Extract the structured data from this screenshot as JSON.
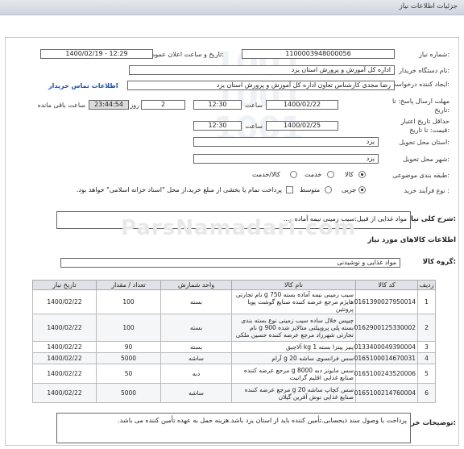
{
  "page_title": "جزئیات اطلاعات نیاز",
  "watermark": "ParsNamadari.com",
  "fields": {
    "need_number": {
      "label": "شماره نیاز:",
      "value": "1100003948000056"
    },
    "announce_datetime": {
      "label": "تاریخ و ساعت اعلان عمومی:",
      "value": "1400/02/19 - 12:29"
    },
    "buyer_org": {
      "label": "نام دستگاه خریدار:",
      "value": "اداره کل آموزش و پرورش استان یزد"
    },
    "requester": {
      "label": "ایجاد کننده درخواست:",
      "value": "رضا مجدی کارشناس تعاون اداره کل آموزش و پرورش استان یزد",
      "link": "اطلاعات تماس خریدار"
    },
    "reply_deadline": {
      "label": "مهلت ارسال پاسخ: تا تاریخ:",
      "date": "1400/02/22",
      "time_label": "ساعت",
      "time": "12:30",
      "days": "2",
      "days_label": "روز و",
      "remaining": "23:44:54",
      "remaining_label": "ساعت باقی مانده"
    },
    "price_validity": {
      "label": "حداقل تاریخ اعتبار قیمت: تا تاریخ:",
      "date": "1400/02/25",
      "time_label": "ساعت",
      "time": "12:30"
    },
    "delivery_province": {
      "label": "استان محل تحویل:",
      "value": "یزد"
    },
    "delivery_city": {
      "label": "شهر محل تحویل:",
      "value": "یزد"
    },
    "category": {
      "label": "طبقه بندی موضوعی:",
      "options": [
        "کالا",
        "خدمت",
        "کالا/خدمت"
      ],
      "selected": "کالا"
    },
    "purchase_type": {
      "label": "نوع فرآیند خرید :",
      "options": [
        "جزیی",
        "متوسط"
      ],
      "selected": "جزیی",
      "note": "پرداخت تمام یا بخشی از مبلغ خرید،از محل \"اسناد خزانه اسلامی\" خواهد بود."
    }
  },
  "summary": {
    "label": "شرح کلی نیاز:",
    "value": "مواد غذایی از قبیل:سیب زمینی نیمه آماده و..."
  },
  "goods_section": {
    "title": "اطلاعات کالاهای مورد نیاز",
    "group_label": "گروه کالا:",
    "group_value": "مواد غذایی و نوشیدنی"
  },
  "table": {
    "headers": [
      "ردیف",
      "کد کالا",
      "نام کالا",
      "واحد شمارش",
      "تعداد / مقدار",
      "تاریخ نیاز"
    ],
    "rows": [
      [
        "1",
        "0161390027950014",
        "سیب زمینی نیمه آماده بسته 750 g نام تجارتی هایژم مرجع عرضه کننده صنایع گوشت پویا پروتئین",
        "بسته",
        "100",
        "1400/02/22"
      ],
      [
        "2",
        "0162900125330002",
        "چیپس خلال ساده سیب زمینی نوع بسته بندی بسته پلی پروپیلنی متالایز شده 900 g نام تجارتی شهرزاد مرجع عرضه کننده حسین ملکی",
        "بسته",
        "100",
        "1400/02/22"
      ],
      [
        "3",
        "0133400049390004",
        "پنیر پیتزا بسته 1 kg آلاچیق",
        "بسته",
        "90",
        "1400/02/22"
      ],
      [
        "4",
        "0165100014670031",
        "سس فرانسوی ساشه 20 g آرام",
        "ساشه",
        "5000",
        "1400/02/22"
      ],
      [
        "5",
        "0165100243520006",
        "سس مایونز دبه 8000 g مرجع عرضه کننده صنایع غذایی اقلیم گرانیت",
        "دبه",
        "50",
        "1400/02/22"
      ],
      [
        "6",
        "0165100214760004",
        "سس کچاپ ساشه 20 g مرجع عرضه کننده صنایع غذایی نوش آفرین گیلان",
        "ساشه",
        "5000",
        "1400/02/22"
      ]
    ]
  },
  "buyer_notes": {
    "label": "توضیحات خریدار:",
    "value": "پرداخت با وصول سند ذیحسابی.تأمین کننده باید از استان یزد باشد.هزینه حمل به عهده تأمین کننده می باشد."
  }
}
